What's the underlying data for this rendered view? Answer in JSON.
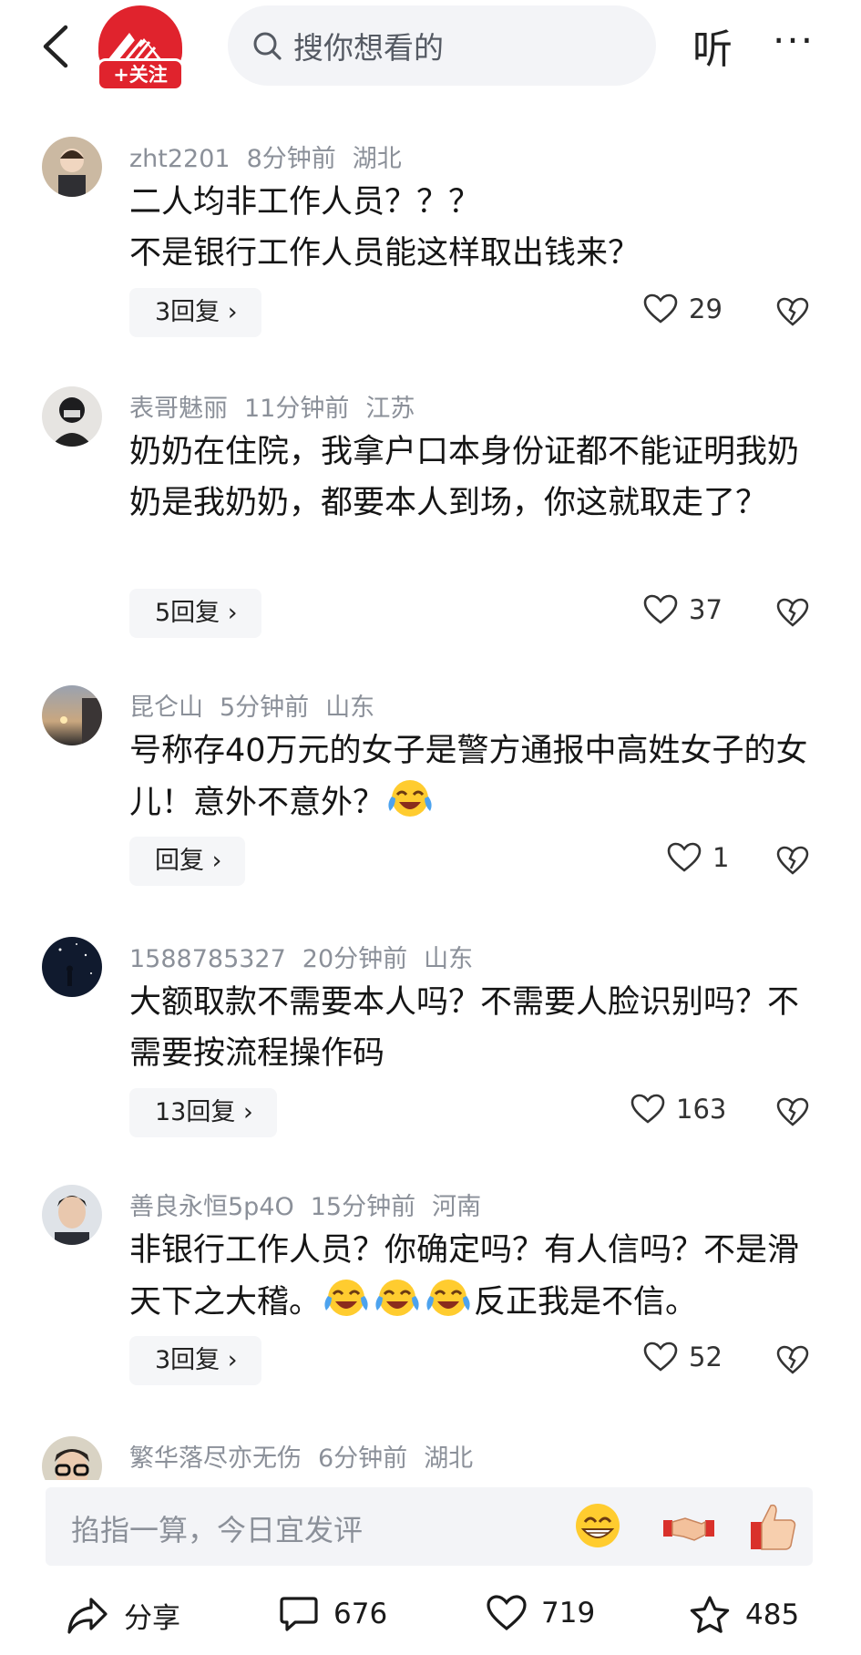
{
  "header": {
    "follow_label": "+关注",
    "search_placeholder": "搜你想看的",
    "listen_label": "听",
    "more_label": "···"
  },
  "comments": [
    {
      "user": "zht2201",
      "time": "8分钟前",
      "location": "湖北",
      "text": "二人均非工作人员？？？\n不是银行工作人员能这样取出钱来？",
      "replies": "3回复 ›",
      "likes": "29"
    },
    {
      "user": "表哥魅丽",
      "time": "11分钟前",
      "location": "江苏",
      "text": "奶奶在住院，我拿户口本身份证都不能证明我奶奶是我奶奶，都要本人到场，你这就取走了？",
      "replies": "5回复 ›",
      "likes": "37"
    },
    {
      "user": "昆仑山",
      "time": "5分钟前",
      "location": "山东",
      "text": "号称存40万元的女子是警方通报中高姓女子的女儿！意外不意外？",
      "replies": "回复 ›",
      "likes": "1"
    },
    {
      "user": "1588785327",
      "time": "20分钟前",
      "location": "山东",
      "text": "大额取款不需要本人吗？不需要人脸识别吗？不需要按流程操作码",
      "replies": "13回复 ›",
      "likes": "163"
    },
    {
      "user": "善良永恒5p4O",
      "time": "15分钟前",
      "location": "河南",
      "text_a": "非银行工作人员？你确定吗？有人信吗？不是滑天下之大稽。",
      "text_b": "反正我是不信。",
      "replies": "3回复 ›",
      "likes": "52"
    },
    {
      "user": "繁华落尽亦无伤",
      "time": "6分钟前",
      "location": "湖北"
    }
  ],
  "input": {
    "placeholder": "掐指一算，今日宜发评"
  },
  "bottom_bar": {
    "share_label": "分享",
    "comment_count": "676",
    "like_count": "719",
    "fav_count": "485"
  },
  "colors": {
    "brand_red": "#e0232d",
    "meta_gray": "#8b9099",
    "pill_bg": "#f5f6f8"
  }
}
